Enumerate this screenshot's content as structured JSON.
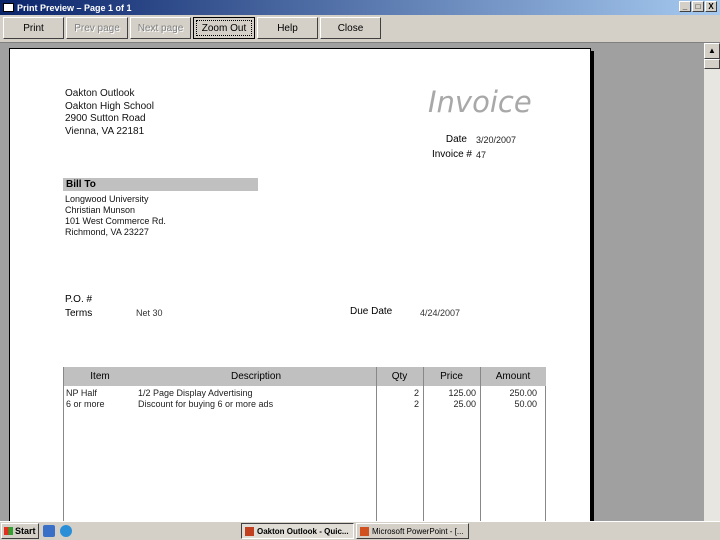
{
  "window": {
    "title": "Print Preview – Page 1 of 1",
    "controls": [
      "_",
      "□",
      "X"
    ]
  },
  "toolbar": {
    "buttons": [
      {
        "label": "Print",
        "disabled": false
      },
      {
        "label": "Prev page",
        "disabled": true
      },
      {
        "label": "Next page",
        "disabled": true
      },
      {
        "label": "Zoom Out",
        "disabled": false
      },
      {
        "label": "Help",
        "disabled": false
      },
      {
        "label": "Close",
        "disabled": false
      }
    ]
  },
  "invoice": {
    "company_lines": [
      "Oakton Outlook",
      "Oakton High School",
      "2900 Sutton Road",
      "Vienna, VA 22181"
    ],
    "title": "Invoice",
    "date_label": "Date",
    "date_value": "3/20/2007",
    "number_label": "Invoice #",
    "number_value": "47",
    "bill_to_header": "Bill To",
    "bill_to_lines": [
      "Longwood University",
      "Christian Munson",
      "101 West Commerce Rd.",
      "Richmond, VA 23227"
    ],
    "po_label": "P.O. #",
    "terms_label": "Terms",
    "terms_value": "Net 30",
    "due_date_label": "Due Date",
    "due_date_value": "4/24/2007",
    "columns": [
      "Item",
      "Description",
      "Qty",
      "Price",
      "Amount"
    ],
    "rows": [
      {
        "item": "NP Half",
        "description": "1/2 Page Display Advertising",
        "qty": "2",
        "price": "125.00",
        "amount": "250.00"
      },
      {
        "item": "6 or more",
        "description": "Discount for buying 6 or more ads",
        "qty": "2",
        "price": "25.00",
        "amount": "50.00"
      }
    ]
  },
  "taskbar": {
    "start_label": "Start",
    "tasks": [
      {
        "label": "Oakton Outlook - Quic...",
        "active": true
      },
      {
        "label": "Microsoft PowerPoint - [...",
        "active": false
      }
    ]
  },
  "colors": {
    "titlebar_start": "#0a246a",
    "titlebar_end": "#a6caf0",
    "preview_bg": "#a0a0a0",
    "table_header": "#c0c0c0",
    "invoice_title": "#a8a8a8"
  }
}
